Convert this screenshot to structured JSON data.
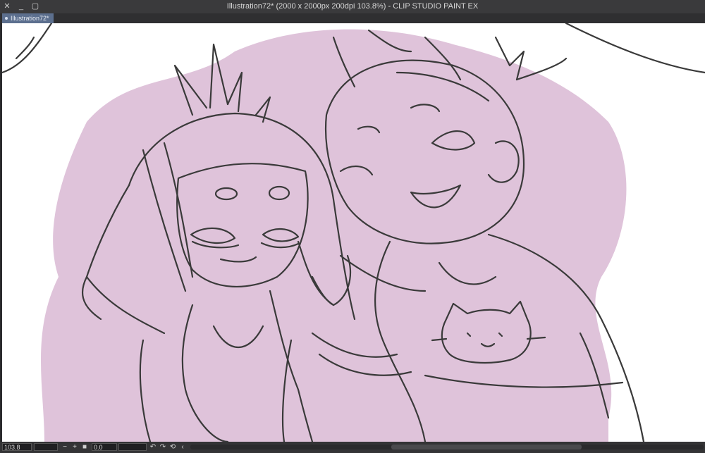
{
  "window": {
    "title": "Illustration72* (2000 x 2000px 200dpi 103.8%)  - CLIP STUDIO PAINT EX",
    "close_glyph": "✕",
    "minimize_glyph": "_",
    "maximize_glyph": "▢"
  },
  "tabs": [
    {
      "label": "Illustration72*"
    }
  ],
  "statusbar": {
    "zoom": "103.8",
    "zoom_out_glyph": "−",
    "zoom_in_glyph": "+",
    "rotation": "0.0",
    "rotate_left_glyph": "↶",
    "rotate_right_glyph": "↷",
    "reset_glyph": "⟲",
    "collapse_glyph": "‹"
  },
  "colors": {
    "accent_tab": "#5c6f8e",
    "sketch_line": "#3a3a3a",
    "background_wash": "#d9b9d4"
  },
  "canvas": {
    "content": "pencil sketch illustration"
  }
}
